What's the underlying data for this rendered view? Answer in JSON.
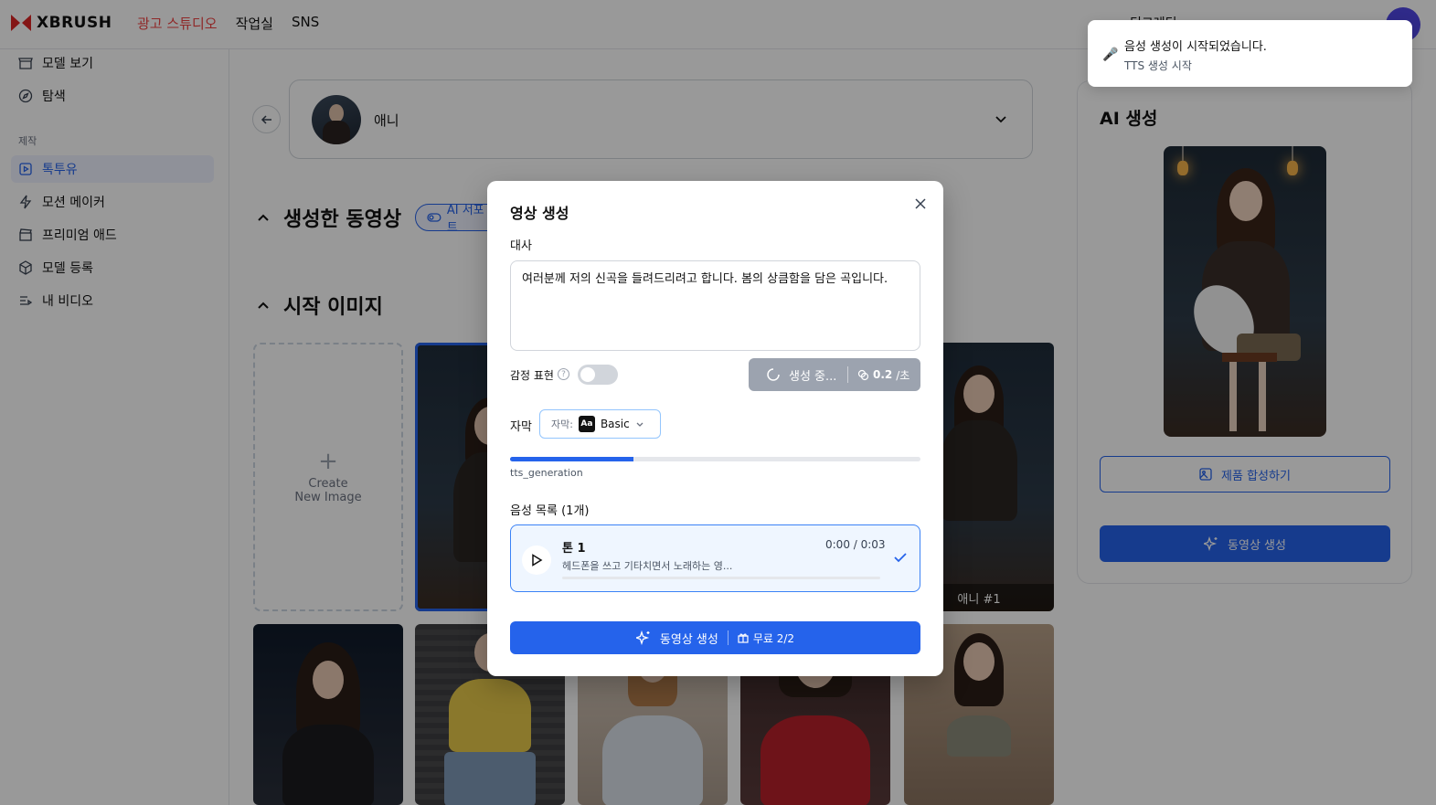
{
  "header": {
    "logo": "XBRUSH",
    "nav": [
      "광고 스튜디오",
      "작업실",
      "SNS"
    ],
    "credit_partial": "딩크레딧"
  },
  "sidebar": {
    "items_top": [
      {
        "label": "모델 보기",
        "icon": "store-icon"
      },
      {
        "label": "탐색",
        "icon": "compass-icon"
      }
    ],
    "section": "제작",
    "items": [
      {
        "label": "톡투유",
        "icon": "play-square-icon",
        "active": true
      },
      {
        "label": "모션 메이커",
        "icon": "bolt-icon"
      },
      {
        "label": "프리미엄 애드",
        "icon": "clapper-icon"
      },
      {
        "label": "모델 등록",
        "icon": "cube-icon"
      },
      {
        "label": "내 비디오",
        "icon": "list-video-icon"
      }
    ]
  },
  "main": {
    "model_name": "애니",
    "section_generated": "생성한 동영상",
    "ai_chip": "AI 서포트",
    "section_start": "시작 이미지",
    "create_card": {
      "line1": "Create",
      "line2": "New Image"
    },
    "thumb_label": "애니 #1"
  },
  "right_panel": {
    "title": "AI 생성",
    "compose_btn": "제품 합성하기",
    "generate_btn": "동영상 생성"
  },
  "modal": {
    "title": "영상 생성",
    "script_label": "대사",
    "script_text": "여러분께 저의 신곡을 들려드리려고 합니다. 봄의 상큼함을 담은 곡입니다.",
    "emotion_label": "감정 표현",
    "emotion_on": false,
    "generating_label": "생성 중...",
    "cost_value": "0.2",
    "cost_unit": "/초",
    "subtitle_label": "자막",
    "subtitle_prefix": "자막:",
    "subtitle_value": "Basic",
    "progress": 0.3,
    "progress_label": "tts_generation",
    "voice_list_label": "음성 목록 (1개)",
    "voice": {
      "name": "톤 1",
      "desc": "헤드폰을 쓰고 기타치면서 노래하는 영...",
      "time": "0:00 / 0:03"
    },
    "submit_label": "동영상 생성",
    "free_label": "무료 2/2"
  },
  "toast": {
    "icon": "🎤",
    "title": "음성 생성이 시작되었습니다.",
    "subtitle": "TTS 생성 시작"
  },
  "colors": {
    "accent": "#2563eb",
    "brand_red": "#ef4444",
    "overlay": "rgba(0,0,0,0.40)"
  }
}
